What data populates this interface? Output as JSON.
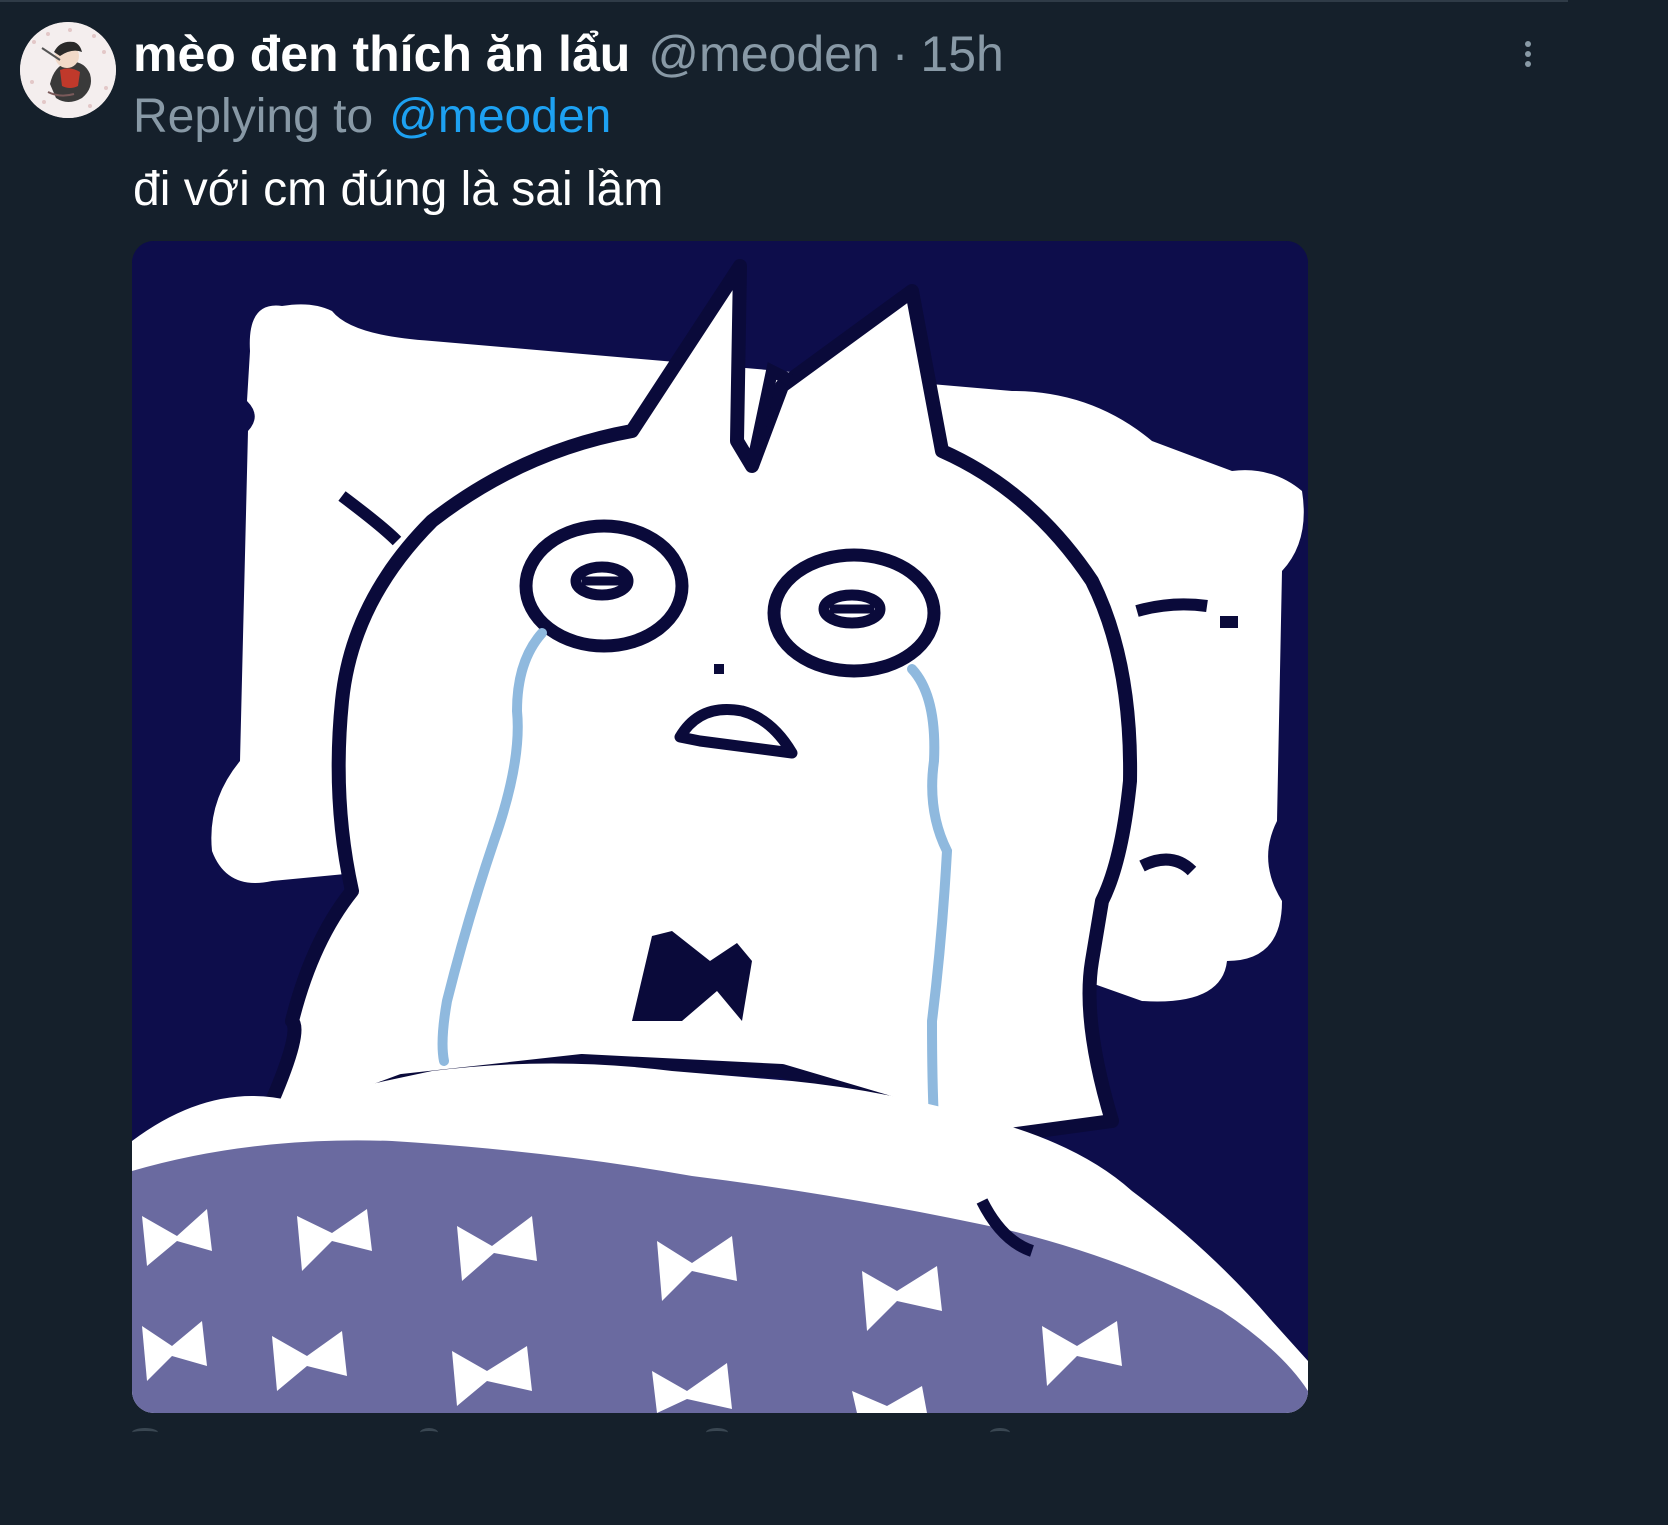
{
  "tweet": {
    "display_name": "mèo đen thích ăn lẩu",
    "handle": "@meoden",
    "separator": "·",
    "time": "15h",
    "replying_prefix": "Replying to",
    "replying_to": "@meoden",
    "text": "đi với cm đúng là sai lầm"
  },
  "icons": {
    "more": "more-vertical-icon",
    "avatar": "profile-avatar-image",
    "media": "crying-cat-in-bed-image"
  },
  "colors": {
    "background": "#15202b",
    "primary_text": "#ffffff",
    "secondary_text": "#8899a6",
    "link": "#1da1f2",
    "image_background": "#0d0d4b",
    "blanket": "#6a6aa0",
    "tears": "#8fb9de"
  }
}
